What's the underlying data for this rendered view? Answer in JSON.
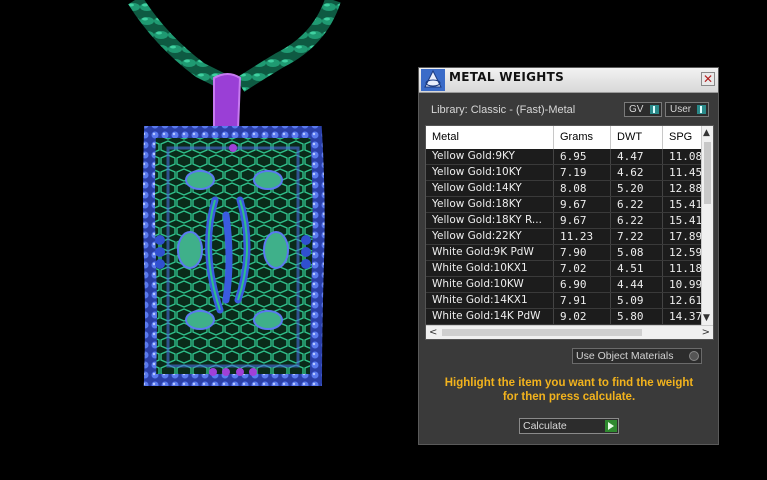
{
  "panel": {
    "title": "METAL WEIGHTS",
    "close_icon": "close-icon",
    "logo_icon": "app-logo-icon",
    "library_label": "Library: Classic - (Fast)-Metal",
    "gv_label": "GV",
    "user_label": "User"
  },
  "table": {
    "columns": [
      "Metal",
      "Grams",
      "DWT",
      "SPG"
    ],
    "rows": [
      [
        "Yellow Gold:9KY",
        "6.95",
        "4.47",
        "11.08"
      ],
      [
        "Yellow Gold:10KY",
        "7.19",
        "4.62",
        "11.45"
      ],
      [
        "Yellow Gold:14KY",
        "8.08",
        "5.20",
        "12.88"
      ],
      [
        "Yellow Gold:18KY",
        "9.67",
        "6.22",
        "15.41"
      ],
      [
        "Yellow Gold:18KY R...",
        "9.67",
        "6.22",
        "15.41"
      ],
      [
        "Yellow Gold:22KY",
        "11.23",
        "7.22",
        "17.89"
      ],
      [
        "White Gold:9K PdW",
        "7.90",
        "5.08",
        "12.59"
      ],
      [
        "White Gold:10KX1",
        "7.02",
        "4.51",
        "11.18"
      ],
      [
        "White Gold:10KW",
        "6.90",
        "4.44",
        "10.99"
      ],
      [
        "White Gold:14KX1",
        "7.91",
        "5.09",
        "12.61"
      ],
      [
        "White Gold:14K PdW",
        "9.02",
        "5.80",
        "14.37"
      ]
    ]
  },
  "options": {
    "use_object_materials": "Use Object Materials"
  },
  "instructions": {
    "line1": "Highlight the item you want to find the weight",
    "line2": "for then press calculate."
  },
  "calculate": {
    "label": "Calculate"
  },
  "colors": {
    "accent": "#f2b31d",
    "rope": "#1f9a72",
    "bail": "#9a3fd6",
    "gem_blue": "#4a6ee0",
    "metal_green": "#2fbf8a"
  }
}
